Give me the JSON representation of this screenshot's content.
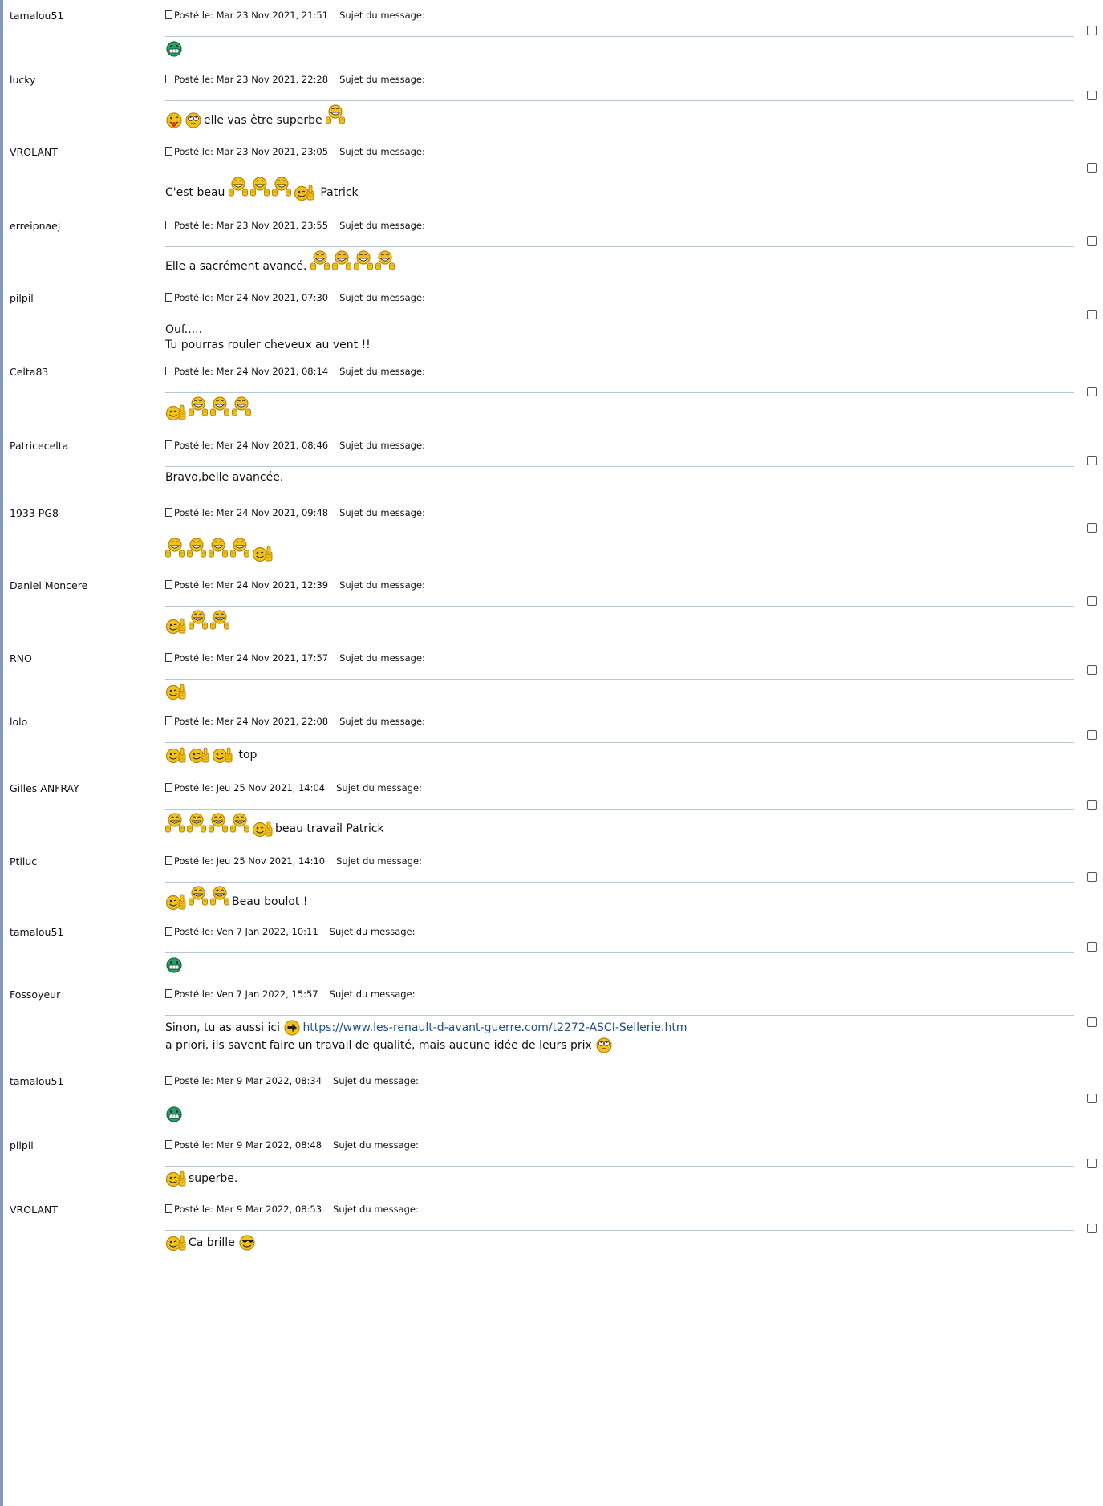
{
  "labels": {
    "posted": "Posté le:",
    "subject": "Sujet du message:"
  },
  "posts": [
    {
      "author": "tamalou51",
      "date": "Mar 23 Nov 2021, 21:51",
      "lines": [
        [
          {
            "i": "grin-green"
          }
        ]
      ]
    },
    {
      "author": "lucky",
      "date": "Mar 23 Nov 2021, 22:28",
      "lines": [
        [
          {
            "i": "tongue"
          },
          {
            "i": "rolleyes"
          },
          {
            "t": "elle vas être superbe "
          },
          {
            "i": "applause"
          }
        ]
      ]
    },
    {
      "author": "VROLANT",
      "date": "Mar 23 Nov 2021, 23:05",
      "lines": [
        [
          {
            "t": "C'est beau "
          },
          {
            "i": "applause"
          },
          {
            "i": "applause"
          },
          {
            "i": "applause"
          },
          {
            "i": "thumbs-up"
          },
          {
            "t": " Patrick"
          }
        ]
      ]
    },
    {
      "author": "erreipnaej",
      "date": "Mar 23 Nov 2021, 23:55",
      "lines": [
        [
          {
            "t": "Elle a sacrément avancé. "
          },
          {
            "i": "applause"
          },
          {
            "i": "applause"
          },
          {
            "i": "applause"
          },
          {
            "i": "applause"
          }
        ]
      ]
    },
    {
      "author": "pilpil",
      "date": "Mer 24 Nov 2021, 07:30",
      "lines": [
        [
          {
            "t": "Ouf....."
          }
        ],
        [
          {
            "t": "Tu pourras rouler cheveux au vent !!"
          }
        ]
      ]
    },
    {
      "author": "Celta83",
      "date": "Mer 24 Nov 2021, 08:14",
      "lines": [
        [
          {
            "i": "thumbs-up"
          },
          {
            "i": "applause"
          },
          {
            "i": "applause"
          },
          {
            "i": "applause"
          }
        ]
      ]
    },
    {
      "author": "Patricecelta",
      "date": "Mer 24 Nov 2021, 08:46",
      "lines": [
        [
          {
            "t": "Bravo,belle avancée."
          }
        ]
      ]
    },
    {
      "author": "1933 PG8",
      "date": "Mer 24 Nov 2021, 09:48",
      "lines": [
        [
          {
            "i": "applause"
          },
          {
            "i": "applause"
          },
          {
            "i": "applause"
          },
          {
            "i": "applause"
          },
          {
            "i": "thumbs-up"
          }
        ]
      ]
    },
    {
      "author": "Daniel Moncere",
      "date": "Mer 24 Nov 2021, 12:39",
      "lines": [
        [
          {
            "i": "thumbs-up"
          },
          {
            "i": "applause"
          },
          {
            "i": "applause"
          }
        ]
      ]
    },
    {
      "author": "RNO",
      "date": "Mer 24 Nov 2021, 17:57",
      "lines": [
        [
          {
            "i": "thumbs-up"
          }
        ]
      ]
    },
    {
      "author": "lolo",
      "date": "Mer 24 Nov 2021, 22:08",
      "lines": [
        [
          {
            "i": "thumbs-up"
          },
          {
            "i": "thumbs-up"
          },
          {
            "i": "thumbs-up"
          },
          {
            "t": " top"
          }
        ]
      ]
    },
    {
      "author": "Gilles ANFRAY",
      "date": "Jeu 25 Nov 2021, 14:04",
      "lines": [
        [
          {
            "i": "applause"
          },
          {
            "i": "applause"
          },
          {
            "i": "applause"
          },
          {
            "i": "applause"
          },
          {
            "i": "thumbs-up"
          },
          {
            "t": "beau travail Patrick"
          }
        ]
      ]
    },
    {
      "author": "Ptiluc",
      "date": "Jeu 25 Nov 2021, 14:10",
      "lines": [
        [
          {
            "i": "thumbs-up"
          },
          {
            "i": "applause"
          },
          {
            "i": "applause"
          },
          {
            "t": "Beau boulot !"
          }
        ]
      ]
    },
    {
      "author": "tamalou51",
      "date": "Ven 7 Jan 2022, 10:11",
      "lines": [
        [
          {
            "i": "grin-green"
          }
        ]
      ]
    },
    {
      "author": "Fossoyeur",
      "date": "Ven 7 Jan 2022, 15:57",
      "lines": [
        [
          {
            "t": "Sinon, tu as aussi ici "
          },
          {
            "i": "arrow"
          },
          {
            "l": "https://www.les-renault-d-avant-guerre.com/t2272-ASCI-Sellerie.htm"
          }
        ],
        [
          {
            "t": "a priori, ils savent faire un travail de qualité, mais aucune idée de leurs prix "
          },
          {
            "i": "rolleyes"
          }
        ]
      ]
    },
    {
      "author": "tamalou51",
      "date": "Mer 9 Mar 2022, 08:34",
      "lines": [
        [
          {
            "i": "grin-green"
          }
        ]
      ]
    },
    {
      "author": "pilpil",
      "date": "Mer 9 Mar 2022, 08:48",
      "lines": [
        [
          {
            "i": "thumbs-up"
          },
          {
            "t": "superbe."
          }
        ]
      ]
    },
    {
      "author": "VROLANT",
      "date": "Mer 9 Mar 2022, 08:53",
      "lines": [
        [
          {
            "i": "thumbs-up"
          },
          {
            "t": "Ca brille "
          },
          {
            "i": "cool"
          }
        ]
      ]
    }
  ],
  "colors": {
    "separator": "#b3c8d8",
    "leftbar": "#7e9ab4",
    "link": "#1f4f8b",
    "smiley": "#f2c21a"
  }
}
